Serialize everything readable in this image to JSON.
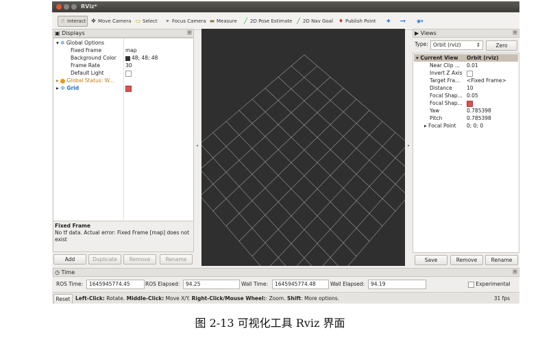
{
  "window": {
    "title": "RViz*"
  },
  "toolbar": {
    "tools": [
      {
        "label": "Interact",
        "icon": "hand-icon"
      },
      {
        "label": "Move Camera",
        "icon": "move-camera-icon"
      },
      {
        "label": "Select",
        "icon": "select-icon"
      },
      {
        "label": "Focus Camera",
        "icon": "focus-camera-icon"
      },
      {
        "label": "Measure",
        "icon": "measure-icon"
      },
      {
        "label": "2D Pose Estimate",
        "icon": "pose-estimate-icon"
      },
      {
        "label": "2D Nav Goal",
        "icon": "nav-goal-icon"
      },
      {
        "label": "Publish Point",
        "icon": "publish-point-icon"
      }
    ]
  },
  "displays": {
    "title": "Displays",
    "global_options": "Global Options",
    "fixed_frame_label": "Fixed Frame",
    "fixed_frame_value": "map",
    "bg_color_label": "Background Color",
    "bg_color_value": "48; 48; 48",
    "frame_rate_label": "Frame Rate",
    "frame_rate_value": "30",
    "default_light_label": "Default Light",
    "global_status": "Global Status: W...",
    "grid": "Grid",
    "desc_title": "Fixed Frame",
    "desc_text": "No tf data. Actual error: Fixed Frame [map] does not exist",
    "buttons": {
      "add": "Add",
      "duplicate": "Duplicate",
      "remove": "Remove",
      "rename": "Rename"
    }
  },
  "views": {
    "title": "Views",
    "type_label": "Type:",
    "type_value": "Orbit (rviz)",
    "zero": "Zero",
    "current_view": "Current View",
    "current_view_value": "Orbit (rviz)",
    "props": [
      {
        "label": "Near Clip ...",
        "value": "0.01"
      },
      {
        "label": "Invert Z Axis",
        "value": ""
      },
      {
        "label": "Target Fra...",
        "value": "<Fixed Frame>"
      },
      {
        "label": "Distance",
        "value": "10"
      },
      {
        "label": "Focal Shap...",
        "value": "0.05"
      },
      {
        "label": "Focal Shap...",
        "value": ""
      },
      {
        "label": "Yaw",
        "value": "0.785398"
      },
      {
        "label": "Pitch",
        "value": "0.785398"
      },
      {
        "label": "Focal Point",
        "value": "0; 0; 0"
      }
    ],
    "buttons": {
      "save": "Save",
      "remove": "Remove",
      "rename": "Rename"
    }
  },
  "time": {
    "title": "Time",
    "ros_time_label": "ROS Time:",
    "ros_time": "1645945774.45",
    "ros_elapsed_label": "ROS Elapsed:",
    "ros_elapsed": "94.25",
    "wall_time_label": "Wall Time:",
    "wall_time": "1645945774.48",
    "wall_elapsed_label": "Wall Elapsed:",
    "wall_elapsed": "94.19",
    "experimental": "Experimental"
  },
  "status": {
    "reset": "Reset",
    "k1": "Left-Click:",
    "t1": " Rotate. ",
    "k2": "Middle-Click:",
    "t2": " Move X/Y. ",
    "k3": "Right-Click/Mouse Wheel:",
    "t3": ": Zoom. ",
    "k4": "Shift",
    "t4": ": More options.",
    "fps": "31 fps"
  },
  "caption": "图 2-13 可视化工具 Rviz 界面",
  "colors": {
    "accent_blue": "#2a6fc9",
    "warning_orange": "#c47a12",
    "viewport_bg": "#303030"
  }
}
